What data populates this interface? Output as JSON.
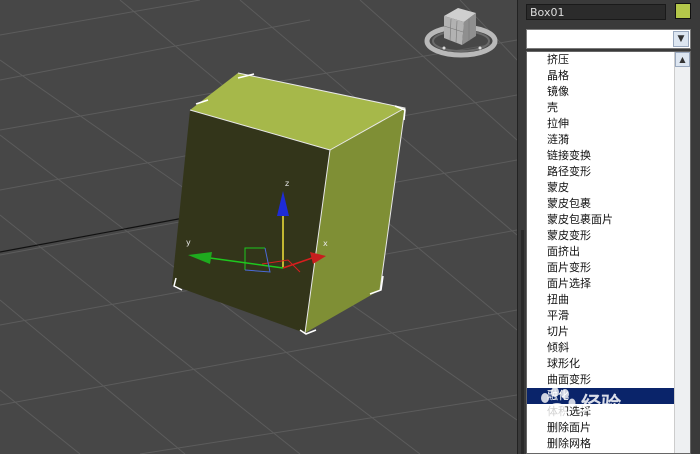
{
  "command_panel": {
    "object_name": "Box01",
    "object_color": "#b4c74a",
    "modifier_list": {
      "selected_value": "",
      "items": [
        "挤压",
        "晶格",
        "镜像",
        "壳",
        "拉伸",
        "涟漪",
        "链接变换",
        "路径变形",
        "蒙皮",
        "蒙皮包裹",
        "蒙皮包裹面片",
        "蒙皮变形",
        "面挤出",
        "面片变形",
        "面片选择",
        "扭曲",
        "平滑",
        "切片",
        "倾斜",
        "球形化",
        "曲面变形",
        "融化",
        "体积选择",
        "删除面片",
        "删除网格"
      ],
      "selected_item": "融化"
    }
  },
  "viewport": {
    "axes": {
      "x": "x",
      "y": "y",
      "z": "z"
    },
    "colors": {
      "background": "#474747",
      "grid": "#5a5a5a",
      "box_top": "#a6b84a",
      "box_front": "#33351a",
      "box_side": "#7f8f35"
    }
  },
  "watermark": {
    "brand": "经验",
    "url": "jingyan.baidu.com"
  }
}
